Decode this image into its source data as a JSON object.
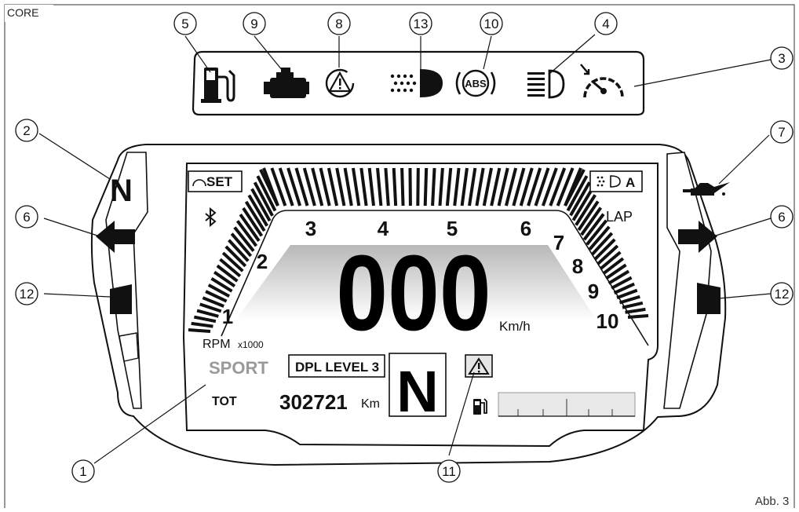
{
  "corner_label": "CORE",
  "figure_label": "Abb. 3",
  "callouts": [
    "5",
    "9",
    "8",
    "13",
    "10",
    "4",
    "3",
    "2",
    "7",
    "6",
    "6",
    "12",
    "12",
    "1",
    "11"
  ],
  "dashboard": {
    "neutral_indicator": "N",
    "cruise_set_label": "SET",
    "drl_auto_label": "A",
    "lap_label": "LAP",
    "rpm_ticks": [
      "1",
      "2",
      "3",
      "4",
      "5",
      "6",
      "7",
      "8",
      "9",
      "10"
    ],
    "speed_value": "000",
    "speed_unit": "Km/h",
    "rpm_unit_label": "RPM",
    "rpm_multiplier": "x1000",
    "riding_mode": "SPORT",
    "dpl_label": "DPL LEVEL 3",
    "gear_value": "N",
    "odometer_label": "TOT",
    "odometer_value": "302721",
    "odometer_unit": "Km",
    "fuel_level_fraction": 0
  },
  "icons": {
    "top_row": [
      "fuel-reserve-icon",
      "engine-check-icon",
      "general-warning-icon",
      "drl-icon",
      "abs-icon",
      "high-beam-icon",
      "cruise-control-icon"
    ],
    "side": [
      "neutral-icon",
      "left-turn-icon",
      "right-turn-icon",
      "oil-pressure-icon",
      "left-flag-icon",
      "right-flag-icon"
    ]
  }
}
